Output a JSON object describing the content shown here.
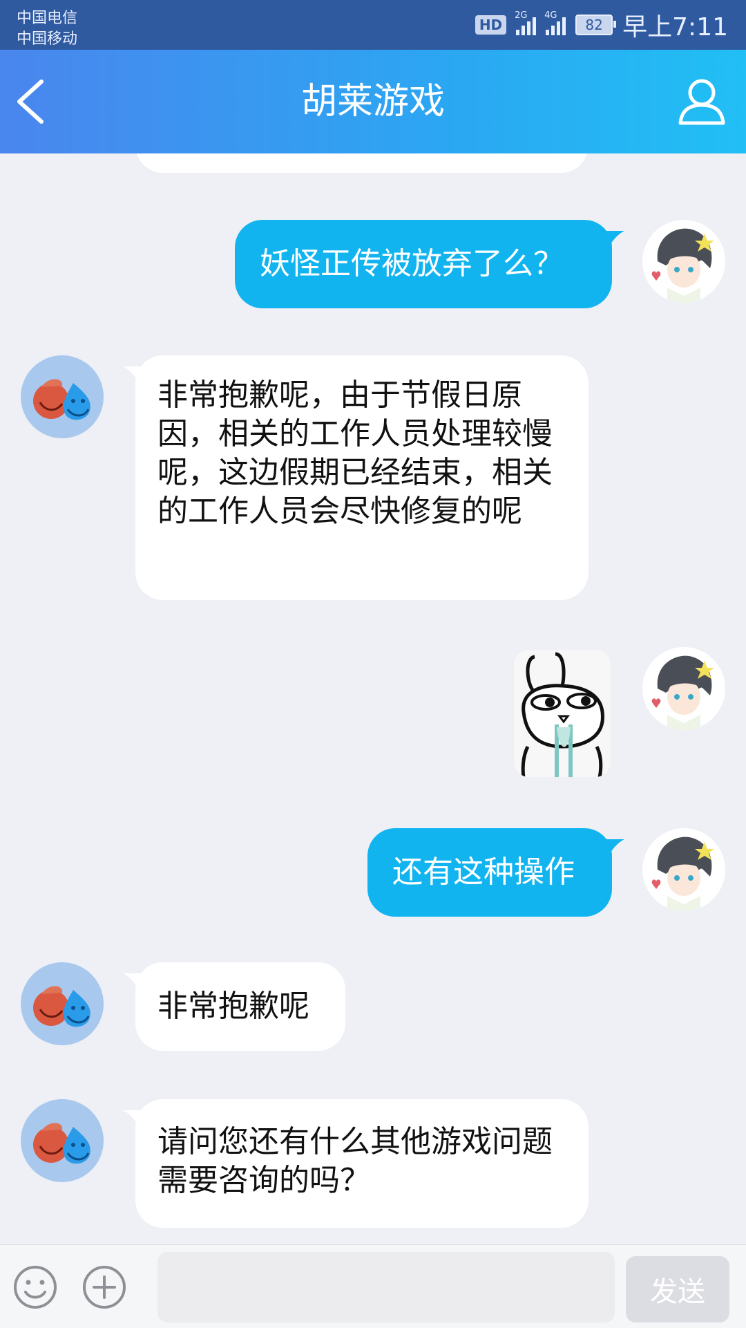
{
  "status_bar": {
    "carrier_1": "中国电信",
    "carrier_2": "中国移动",
    "hd_badge": "HD",
    "signal_1_label": "2G",
    "signal_2_label": "4G",
    "battery": "82",
    "time": "早上7:11"
  },
  "header": {
    "title": "胡莱游戏",
    "back_icon": "chevron-left-icon",
    "profile_icon": "person-icon"
  },
  "messages": [
    {
      "side": "right",
      "text": "妖怪正传被放弃了么？"
    },
    {
      "side": "left",
      "text": "非常抱歉呢，由于节假日原因，相关的工作人员处理较慢呢，这边假期已经结束，相关的工作人员会尽快修复的呢"
    },
    {
      "side": "right",
      "type": "sticker",
      "sticker": "rabbit-sticker"
    },
    {
      "side": "right",
      "text": "还有这种操作"
    },
    {
      "side": "left",
      "text": "非常抱歉呢"
    },
    {
      "side": "left",
      "text": "请问您还有什么其他游戏问题需要咨询的吗？"
    }
  ],
  "input_bar": {
    "emoji_icon": "smiley-icon",
    "plus_icon": "plus-circle-icon",
    "input_value": "",
    "send_label": "发送"
  },
  "colors": {
    "header_start": "#4a86ee",
    "header_end": "#21bff5",
    "outgoing_bubble": "#12b4f0",
    "incoming_bubble": "#ffffff",
    "background": "#eef0f6"
  }
}
